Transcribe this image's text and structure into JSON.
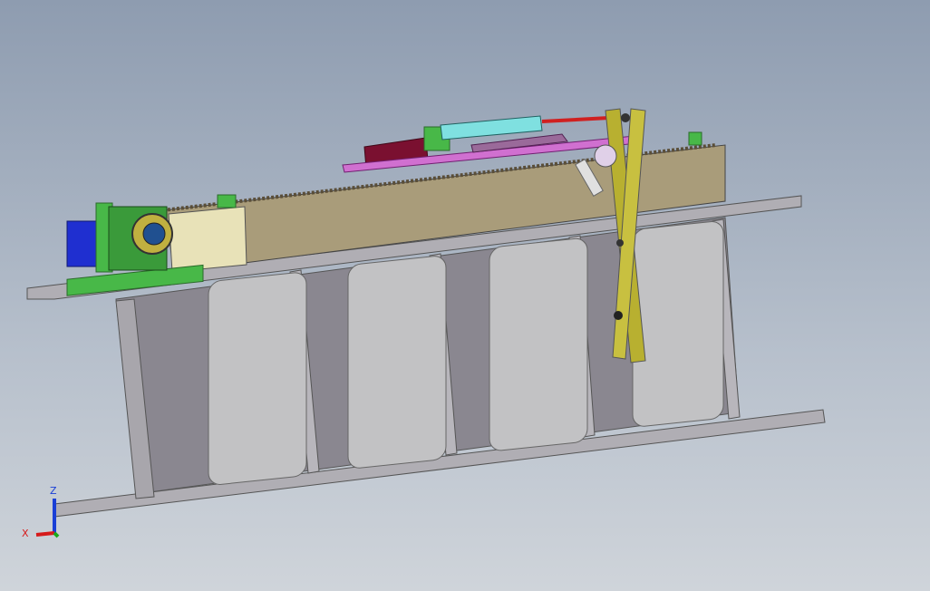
{
  "viewport": {
    "background_top": "#8e9cb0",
    "background_bottom": "#cfd4da"
  },
  "triad": {
    "z_label": "Z",
    "x_label": "X",
    "z_color": "#1a3fd6",
    "x_color": "#d61a1a",
    "y_color": "#1aa81a"
  },
  "model": {
    "beam_color": "#a8a6ac",
    "web_color": "#8a8790",
    "panel_color": "#c2c2c4",
    "rail_color": "#a99c7a",
    "motor_color": "#1f2fd0",
    "bracket_color": "#48b848",
    "linkage_color": "#b8b030",
    "cylinder_color": "#7fe0e0",
    "carriage_color": "#d070d0",
    "rod_color": "#d02020",
    "spring_color": "#e0e0e0",
    "block_color": "#7a1030"
  }
}
